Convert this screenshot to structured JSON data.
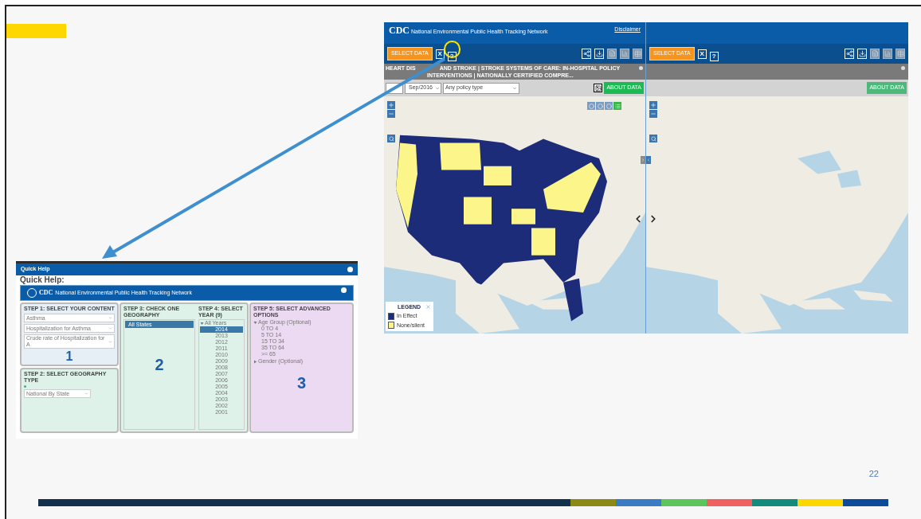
{
  "slide": {
    "page_number": "22"
  },
  "map_app": {
    "left_pane": {
      "header": {
        "logo": "CDC",
        "title": "National Environmental Public Health Tracking Network",
        "link": "Disclaimer"
      },
      "toolbar": {
        "select_button": "SELECT DATA",
        "clear_button": "X",
        "help_button": "?",
        "help_highlighted": true,
        "tools": [
          {
            "kind": "share",
            "disabled": false
          },
          {
            "kind": "download",
            "disabled": false
          },
          {
            "kind": "document",
            "disabled": true
          },
          {
            "kind": "chart",
            "disabled": true
          },
          {
            "kind": "table",
            "disabled": true
          }
        ]
      },
      "title_bar": [
        "HEART DIS",
        "AND STROKE | STROKE SYSTEMS OF CARE: IN-HOSPITAL POLICY INTERVENTIONS | NATIONALLY CERTIFIED COMPRE..."
      ],
      "filters": {
        "date": "Sep/2016",
        "policy": "Any policy type"
      },
      "about_button": "ABOUT DATA",
      "legend": {
        "title": "LEGEND",
        "items": [
          {
            "label": "In Effect",
            "color": "#1c2c78"
          },
          {
            "label": "None/silent",
            "color": "#fbf58a"
          }
        ]
      }
    },
    "right_pane": {
      "toolbar": {
        "select_button": "SELECT DATA",
        "clear_button": "X",
        "help_button": "?",
        "tools": [
          {
            "kind": "share",
            "disabled": false
          },
          {
            "kind": "download",
            "disabled": false
          },
          {
            "kind": "document",
            "disabled": true
          },
          {
            "kind": "chart",
            "disabled": true
          },
          {
            "kind": "table",
            "disabled": true
          }
        ]
      },
      "about_button": "ABOUT DATA"
    }
  },
  "quick_help": {
    "window_title": "Quick Help",
    "heading": "Quick Help:",
    "banner": {
      "logo": "CDC",
      "title": "National Environmental Public Health Tracking Network"
    },
    "step1": {
      "title": "STEP 1: SELECT YOUR CONTENT",
      "number": "1",
      "dropdowns": [
        "Asthma",
        "Hospitalization for Asthma",
        "Crude rate of Hospitalization for A"
      ]
    },
    "step2": {
      "title": "STEP 2: SELECT GEOGRAPHY TYPE",
      "dropdown": "National By State"
    },
    "step3": {
      "title": "STEP 3: CHECK ONE GEOGRAPHY",
      "number": "2",
      "items": [
        {
          "label": "All States",
          "selected": true
        }
      ]
    },
    "step4": {
      "title": "STEP 4: SELECT YEAR (9)",
      "group": {
        "label": "All Years",
        "expanded": true
      },
      "years": [
        {
          "label": "2014",
          "selected": true
        },
        {
          "label": "2013",
          "selected": false
        },
        {
          "label": "2012",
          "selected": false
        },
        {
          "label": "2011",
          "selected": false
        },
        {
          "label": "2010",
          "selected": false
        },
        {
          "label": "2009",
          "selected": false
        },
        {
          "label": "2008",
          "selected": false
        },
        {
          "label": "2007",
          "selected": false
        },
        {
          "label": "2006",
          "selected": false
        },
        {
          "label": "2005",
          "selected": false
        },
        {
          "label": "2004",
          "selected": false
        },
        {
          "label": "2003",
          "selected": false
        },
        {
          "label": "2002",
          "selected": false
        },
        {
          "label": "2001",
          "selected": false
        }
      ]
    },
    "step5": {
      "title": "STEP 5: SELECT ADVANCED OPTIONS",
      "number": "3",
      "options": [
        {
          "label": "Age Group (Optional)",
          "expanded": true,
          "children": [
            {
              "label": "0 TO 4"
            },
            {
              "label": "5 TO 14"
            },
            {
              "label": "15 TO 34"
            },
            {
              "label": "35 TO 64"
            },
            {
              "label": ">= 65"
            }
          ]
        },
        {
          "label": "Gender (Optional)",
          "expanded": false
        }
      ]
    }
  }
}
